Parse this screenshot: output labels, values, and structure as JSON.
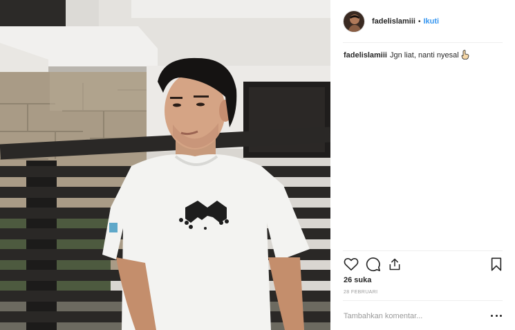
{
  "post": {
    "username": "fadelislamiii",
    "separator": "•",
    "follow_label": "Ikuti",
    "avatar_icon": "profile-avatar",
    "caption": {
      "username": "fadelislamiii",
      "text": "Jgn liat, nanti nyesal",
      "emoji_icon": "pointing-hand-icon"
    },
    "likes_text": "26 suka",
    "date_text": "28 FEBRUARI",
    "comment_placeholder": "Tambahkan komentar...",
    "actions": {
      "like_icon": "heart-icon",
      "comment_icon": "comment-icon",
      "share_icon": "share-icon",
      "save_icon": "bookmark-icon",
      "more_icon": "more-options-icon"
    }
  },
  "colors": {
    "link_blue": "#3897f0",
    "text": "#262626",
    "muted": "#999999",
    "divider": "#efefef"
  }
}
